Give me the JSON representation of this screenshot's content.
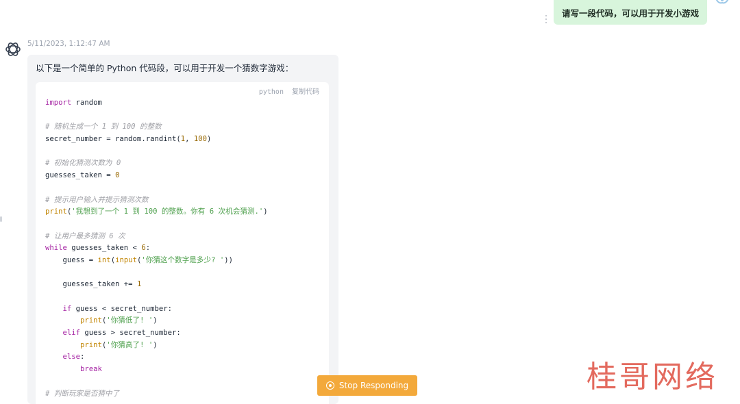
{
  "user_message": {
    "text": "请写一段代码，可以用于开发小游戏"
  },
  "assistant": {
    "timestamp": "5/11/2023, 1:12:47 AM",
    "intro": "以下是一个简单的 Python 代码段，可以用于开发一个猜数字游戏：",
    "code_block": {
      "language": "python",
      "copy_label": "复制代码",
      "lines": [
        [
          [
            "kw",
            "import"
          ],
          [
            "t",
            " random"
          ]
        ],
        [],
        [
          [
            "cm",
            "# 随机生成一个 1 到 100 的整数"
          ]
        ],
        [
          [
            "t",
            "secret_number = random.randint("
          ],
          [
            "num",
            "1"
          ],
          [
            "t",
            ", "
          ],
          [
            "num",
            "100"
          ],
          [
            "t",
            ")"
          ]
        ],
        [],
        [
          [
            "cm",
            "# 初始化猜测次数为 0"
          ]
        ],
        [
          [
            "t",
            "guesses_taken = "
          ],
          [
            "num",
            "0"
          ]
        ],
        [],
        [
          [
            "cm",
            "# 提示用户输入并提示猜测次数"
          ]
        ],
        [
          [
            "bi",
            "print"
          ],
          [
            "t",
            "("
          ],
          [
            "str",
            "'我想到了一个 1 到 100 的整数。你有 6 次机会猜测.'"
          ],
          [
            "t",
            ")"
          ]
        ],
        [],
        [
          [
            "cm",
            "# 让用户最多猜测 6 次"
          ]
        ],
        [
          [
            "kw",
            "while"
          ],
          [
            "t",
            " guesses_taken < "
          ],
          [
            "num",
            "6"
          ],
          [
            "t",
            ":"
          ]
        ],
        [
          [
            "t",
            "    guess = "
          ],
          [
            "bi",
            "int"
          ],
          [
            "t",
            "("
          ],
          [
            "bi",
            "input"
          ],
          [
            "t",
            "("
          ],
          [
            "str",
            "'你猜这个数字是多少? '"
          ],
          [
            "t",
            "))"
          ]
        ],
        [],
        [
          [
            "t",
            "    guesses_taken += "
          ],
          [
            "num",
            "1"
          ]
        ],
        [],
        [
          [
            "t",
            "    "
          ],
          [
            "kw",
            "if"
          ],
          [
            "t",
            " guess < secret_number:"
          ]
        ],
        [
          [
            "t",
            "        "
          ],
          [
            "bi",
            "print"
          ],
          [
            "t",
            "("
          ],
          [
            "str",
            "'你猜低了! '"
          ],
          [
            "t",
            ")"
          ]
        ],
        [
          [
            "t",
            "    "
          ],
          [
            "kw",
            "elif"
          ],
          [
            "t",
            " guess > secret_number:"
          ]
        ],
        [
          [
            "t",
            "        "
          ],
          [
            "bi",
            "print"
          ],
          [
            "t",
            "("
          ],
          [
            "str",
            "'你猜高了! '"
          ],
          [
            "t",
            ")"
          ]
        ],
        [
          [
            "t",
            "    "
          ],
          [
            "kw",
            "else"
          ],
          [
            "t",
            ":"
          ]
        ],
        [
          [
            "t",
            "        "
          ],
          [
            "kw",
            "break"
          ]
        ],
        [],
        [
          [
            "cm",
            "# 判断玩家是否猜中了"
          ]
        ]
      ]
    }
  },
  "stop_button": {
    "label": "Stop Responding"
  },
  "watermark": {
    "text": "桂哥网络"
  },
  "colors": {
    "user_bubble": "#d8f5dc",
    "stop_button": "#f3a93b",
    "watermark": "#e05a4d"
  }
}
